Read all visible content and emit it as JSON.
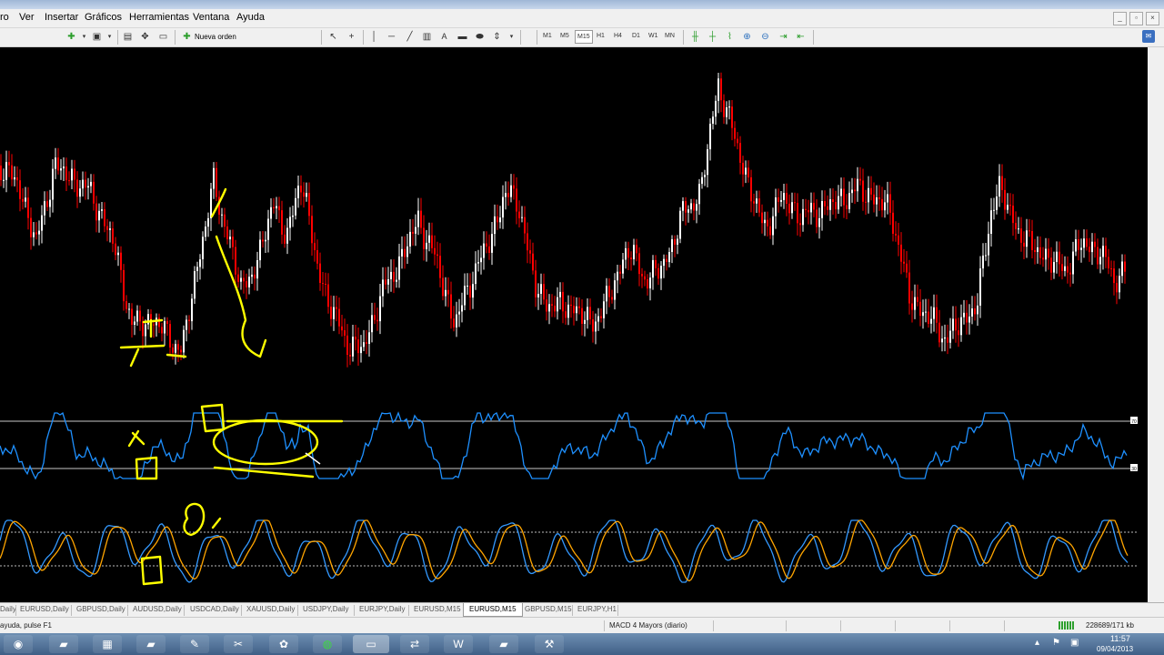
{
  "menu": {
    "items": [
      "ro",
      "Ver",
      "Insertar",
      "Gráficos",
      "Herramientas",
      "Ventana",
      "Ayuda"
    ],
    "mdi_buttons": [
      "_",
      "▫",
      "×"
    ]
  },
  "toolbar": {
    "new_order_label": "Nueva orden",
    "timeframes": [
      "M1",
      "M5",
      "M15",
      "H1",
      "H4",
      "D1",
      "W1",
      "MN"
    ],
    "active_timeframe": "M15",
    "icons": {
      "new_chart": "plus-chart-icon",
      "profiles": "window-icon",
      "cursor": "cursor-icon",
      "crosshair": "crosshair-icon",
      "vline": "vertical-line-icon",
      "hline": "horizontal-line-icon",
      "trendline": "trendline-icon",
      "channel": "channel-icon",
      "text": "text-icon",
      "label": "label-icon",
      "shapes": "shapes-icon",
      "arrows": "arrows-icon",
      "bar_chart": "bar-chart-icon",
      "candles": "candles-icon",
      "line_chart": "line-chart-icon",
      "zoom_in": "zoom-in-icon",
      "zoom_out": "zoom-out-icon",
      "autoscroll": "autoscroll-icon",
      "shift": "chart-shift-icon"
    }
  },
  "chart": {
    "background": "#000000",
    "bull_color": "#ffffff",
    "bear_color": "#ff0000",
    "rsi_color": "#1e90ff",
    "stoch_main_color": "#3399ff",
    "stoch_signal_color": "#ffa500",
    "annotation_color": "#ffff00",
    "rsi_upper_marker": "70",
    "rsi_lower_marker": "30"
  },
  "tabs": {
    "items": [
      "Daily",
      "EURUSD,Daily",
      "GBPUSD,Daily",
      "AUDUSD,Daily",
      "USDCAD,Daily",
      "XAUUSD,Daily",
      "USDJPY,Daily",
      "EURJPY,Daily",
      "EURUSD,M15",
      "EURUSD,M15",
      "GBPUSD,M15",
      "EURJPY,H1"
    ],
    "active_index": 9
  },
  "status": {
    "help_text": "ayuda, pulse F1",
    "profile": "MACD 4 Mayors (diario)",
    "connection": "228689/171 kb"
  },
  "taskbar": {
    "apps": [
      "chrome-icon",
      "folder-icon",
      "calculator-icon",
      "folder-icon",
      "pen-icon",
      "paint-icon",
      "flower-icon",
      "spotify-icon",
      "app-icon",
      "teamviewer-icon",
      "word-icon",
      "folder-icon",
      "metatrader-icon"
    ],
    "time": "11:57",
    "date": "09/04/2013"
  }
}
